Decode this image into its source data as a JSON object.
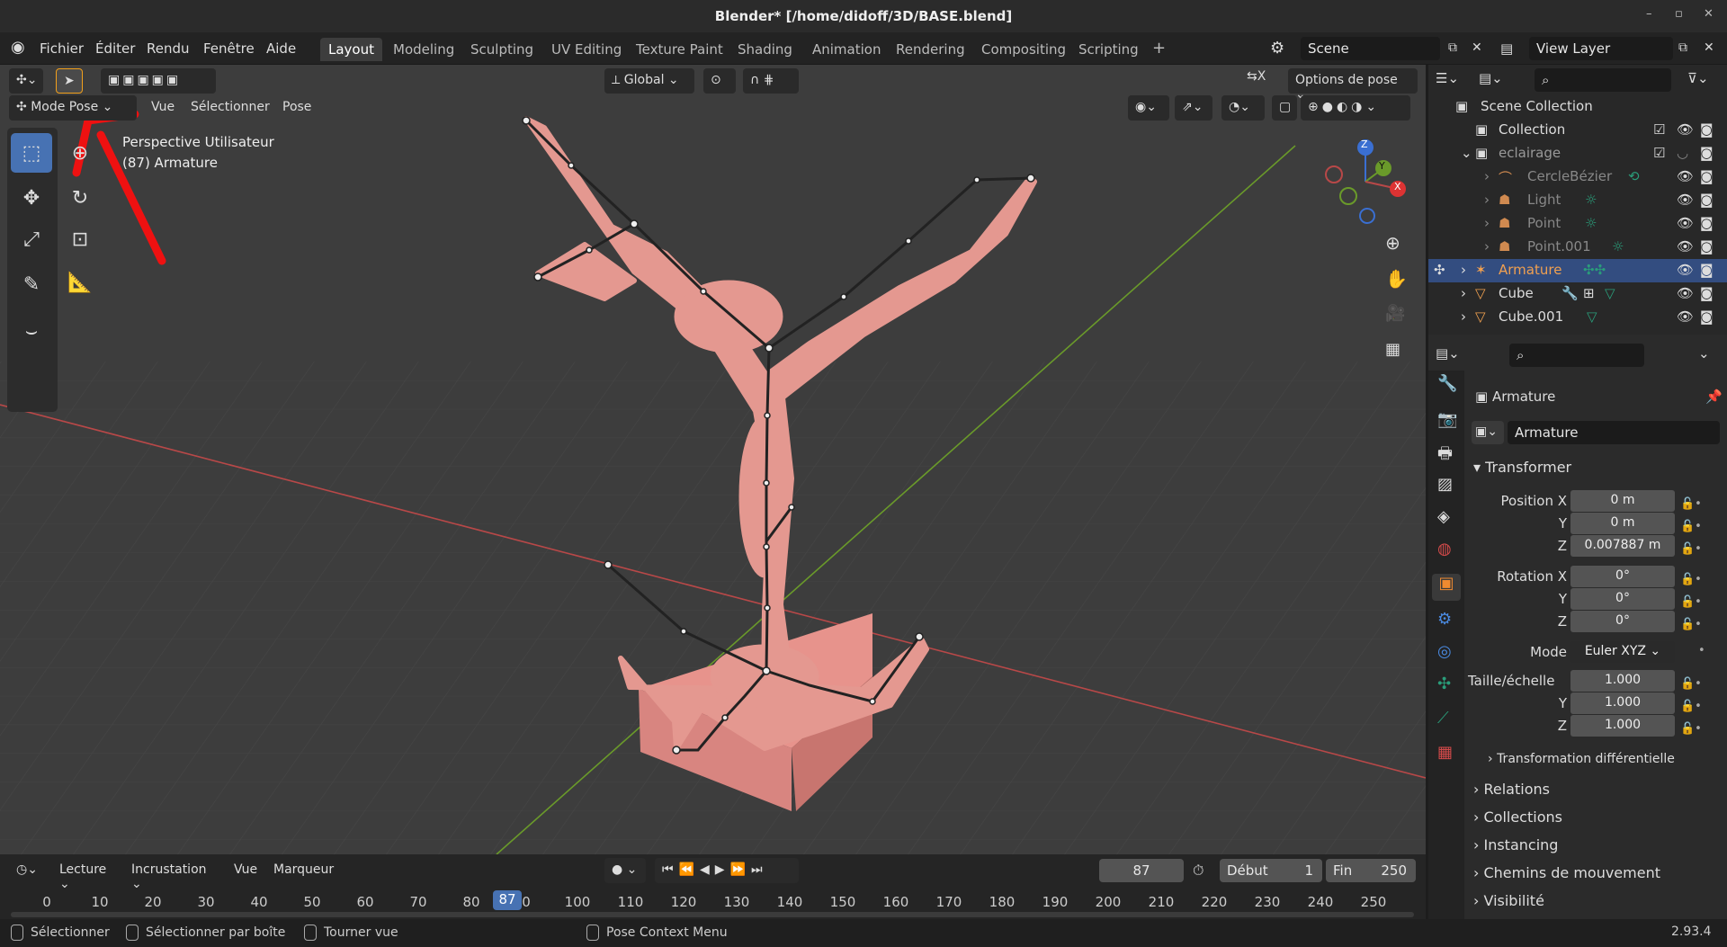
{
  "window": {
    "title": "Blender* [/home/didoff/3D/BASE.blend]"
  },
  "menu": [
    "Fichier",
    "Éditer",
    "Rendu",
    "Fenêtre",
    "Aide"
  ],
  "workspaces": [
    "Layout",
    "Modeling",
    "Sculpting",
    "UV Editing",
    "Texture Paint",
    "Shading",
    "Animation",
    "Rendering",
    "Compositing",
    "Scripting"
  ],
  "active_workspace": "Layout",
  "scene": "Scene",
  "view_layer": "View Layer",
  "viewport": {
    "mode": "Mode Pose",
    "menus": [
      "Vue",
      "Sélectionner",
      "Pose"
    ],
    "orientation": "Global",
    "pose_options": "Options de pose",
    "overlay_text": [
      "Perspective Utilisateur",
      "(87) Armature"
    ],
    "axis_labels": {
      "z": "Z",
      "y": "Y",
      "x": "X"
    },
    "mesh_color": "#e49890",
    "base_color": "#e7938c"
  },
  "outliner": {
    "root": "Scene Collection",
    "items": [
      {
        "label": "Collection",
        "level": 0
      },
      {
        "label": "eclairage",
        "level": 0
      },
      {
        "label": "CercleBézier",
        "level": 1
      },
      {
        "label": "Light",
        "level": 1
      },
      {
        "label": "Point",
        "level": 1
      },
      {
        "label": "Point.001",
        "level": 1
      },
      {
        "label": "Armature",
        "level": 0,
        "selected": true
      },
      {
        "label": "Cube",
        "level": 0
      },
      {
        "label": "Cube.001",
        "level": 0
      }
    ]
  },
  "properties": {
    "object_name": "Armature",
    "data_name": "Armature",
    "section": "Transformer",
    "position_label": "Position X",
    "rotation_label": "Rotation X",
    "y": "Y",
    "z": "Z",
    "position": [
      "0 m",
      "0 m",
      "0.007887 m"
    ],
    "rotation": [
      "0°",
      "0°",
      "0°"
    ],
    "mode_label": "Mode",
    "mode": "Euler XYZ",
    "scale_label": "Taille/échelle",
    "scale": [
      "1.000",
      "1.000",
      "1.000"
    ],
    "delta": "Transformation différentielle",
    "sections": [
      "Relations",
      "Collections",
      "Instancing",
      "Chemins de mouvement",
      "Visibilité"
    ]
  },
  "timeline": {
    "menus": [
      "Lecture",
      "Incrustation",
      "Vue",
      "Marqueur"
    ],
    "frame": "87",
    "start_label": "Début",
    "start": "1",
    "end_label": "Fin",
    "end": "250",
    "ticks": [
      "0",
      "10",
      "20",
      "30",
      "40",
      "50",
      "60",
      "70",
      "80",
      "87",
      "0",
      "100",
      "110",
      "120",
      "130",
      "140",
      "150",
      "160",
      "170",
      "180",
      "190",
      "200",
      "210",
      "220",
      "230",
      "240",
      "250"
    ]
  },
  "status": {
    "items": [
      "Sélectionner",
      "Sélectionner par boîte",
      "Tourner vue",
      "Pose Context Menu"
    ],
    "version": "2.93.4"
  },
  "colors": {
    "accent": "#4772b3",
    "red_axis": "#b84848",
    "green_axis": "#6a9a2a",
    "annotation": "#ee1111"
  }
}
